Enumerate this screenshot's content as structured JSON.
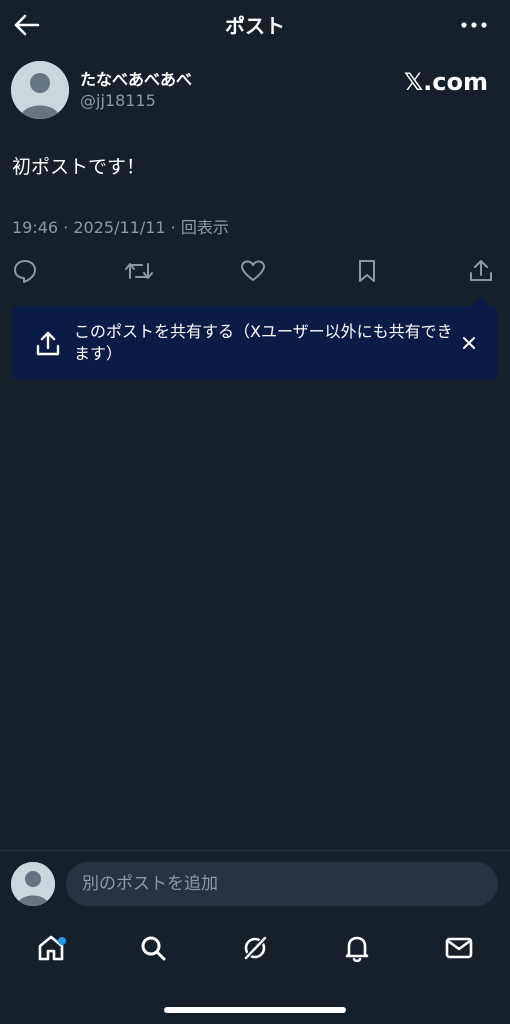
{
  "header": {
    "title": "ポスト"
  },
  "post": {
    "author_name": "たなべあべあべ",
    "author_handle": "@jj18115",
    "brand": "𝕏.com",
    "text": "初ポストです！",
    "meta": "19:46 · 2025/11/11 · 回表示"
  },
  "actions": [
    "reply-icon",
    "repost-icon",
    "like-icon",
    "bookmark-icon",
    "share-icon"
  ],
  "toast": {
    "text": "このポストを共有する（Xユーザー以外にも共有できます）"
  },
  "reply": {
    "placeholder": "別のポストを追加"
  },
  "tabs": [
    "home-icon",
    "search-icon",
    "grok-icon",
    "notifications-icon",
    "messages-icon"
  ],
  "colors": {
    "background": "#15202b",
    "toast": "#0a1b45",
    "accent": "#1d9bf0",
    "muted": "#8b98a5"
  }
}
